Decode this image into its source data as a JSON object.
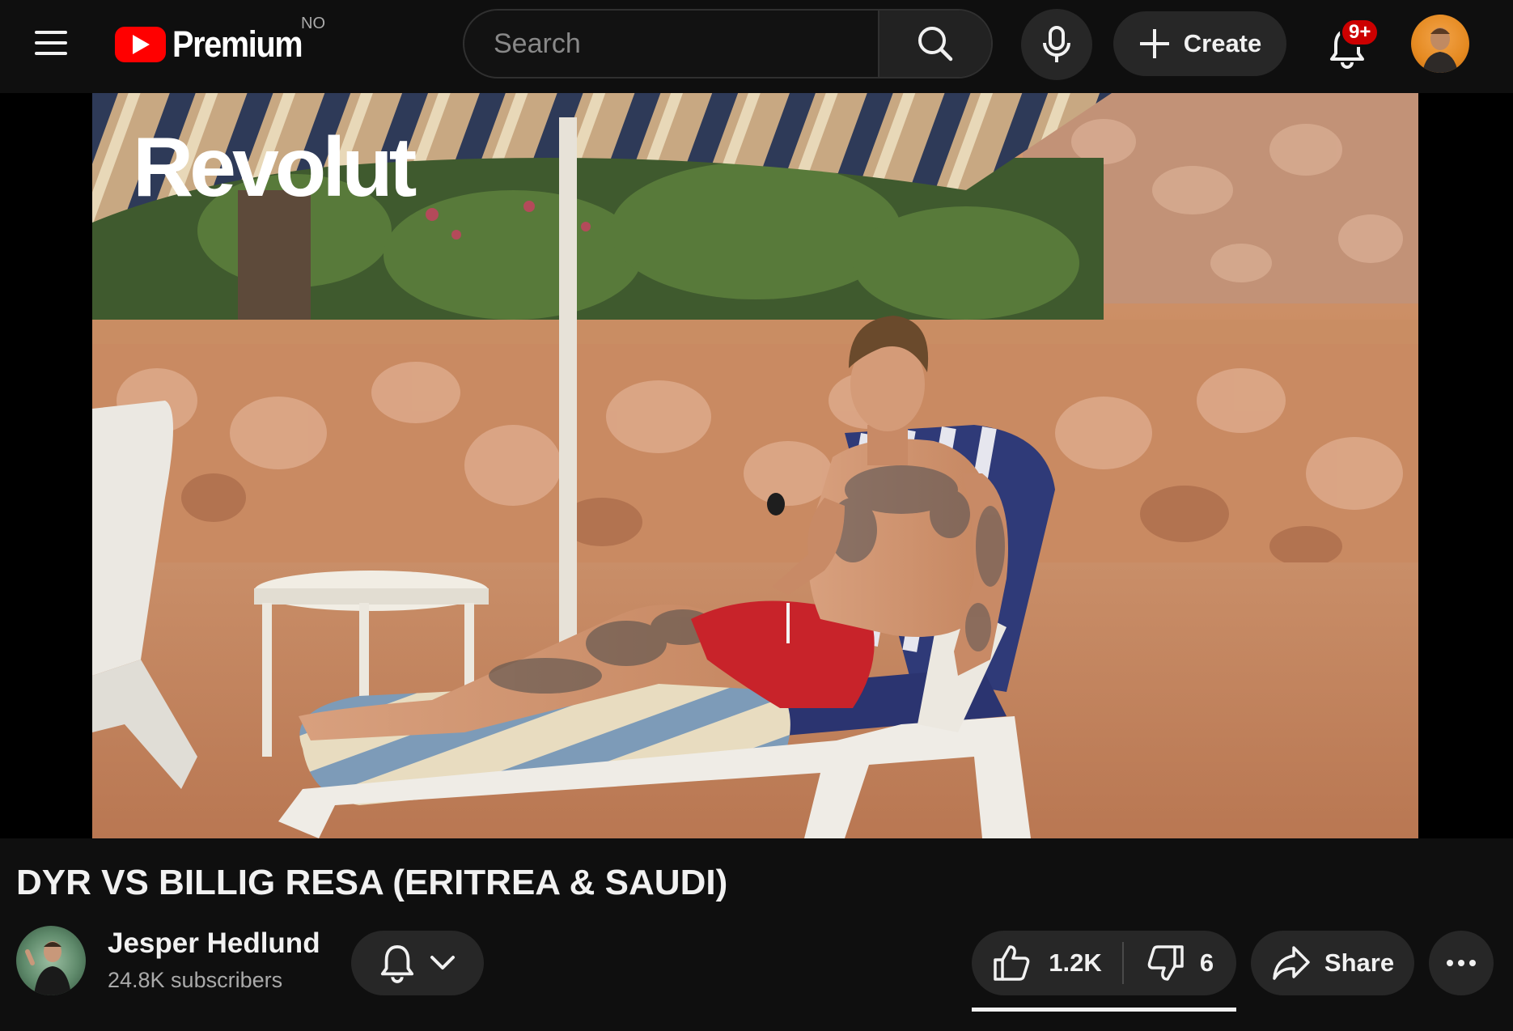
{
  "header": {
    "logo_text": "Premium",
    "country_code": "NO",
    "search": {
      "placeholder": "Search",
      "value": ""
    },
    "create_label": "Create",
    "notification_badge": "9+"
  },
  "video": {
    "watermark": "Revolut",
    "title": "DYR VS BILLIG RESA (ERITREA & SAUDI)"
  },
  "channel": {
    "name": "Jesper Hedlund",
    "subscribers": "24.8K subscribers"
  },
  "actions": {
    "likes": "1.2K",
    "dislikes": "6",
    "share_label": "Share"
  },
  "colors": {
    "background": "#0f0f0f",
    "button_bg": "#272727",
    "brand_red": "#ff0000",
    "badge_red": "#cc0000",
    "text_primary": "#f1f1f1",
    "text_secondary": "#aaaaaa"
  },
  "icons": {
    "menu": "hamburger-menu-icon",
    "logo": "youtube-play-icon",
    "search": "search-icon",
    "mic": "microphone-icon",
    "create": "plus-icon",
    "notifications": "bell-icon",
    "subscribe": "bell-icon",
    "subscribe_dropdown": "chevron-down-icon",
    "like": "thumbs-up-icon",
    "dislike": "thumbs-down-icon",
    "share": "share-arrow-icon",
    "more": "more-horizontal-icon"
  }
}
